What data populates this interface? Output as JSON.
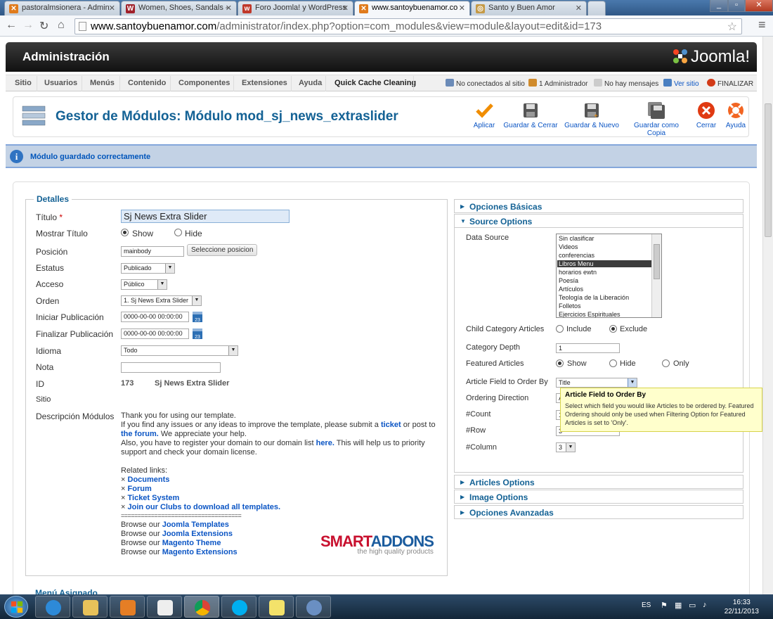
{
  "browser": {
    "tabs": [
      {
        "title": "pastoralmsionera - Admin",
        "active": false
      },
      {
        "title": "Women, Shoes, Sandals -",
        "active": false
      },
      {
        "title": "Foro Joomla! y WordPress",
        "active": false
      },
      {
        "title": "www.santoybuenamor.co",
        "active": true
      },
      {
        "title": "Santo y Buen Amor",
        "active": false
      }
    ],
    "url_host": "www.santoybuenamor.com",
    "url_rest": "/administrator/index.php?option=com_modules&view=module&layout=edit&id=173"
  },
  "admin": {
    "title": "Administración",
    "logo": "Joomla!"
  },
  "menu": {
    "items": [
      "Sitio",
      "Usuarios",
      "Menús",
      "Contenido",
      "Componentes",
      "Extensiones",
      "Ayuda",
      "Quick Cache Cleaning"
    ],
    "status": {
      "not_connected": "No conectados al sitio",
      "admins": "1 Administrador",
      "messages": "No hay mensajes",
      "view_site": "Ver sitio",
      "logout": "FINALIZAR"
    }
  },
  "page": {
    "title": "Gestor de Módulos: Módulo mod_sj_news_extraslider",
    "toolbar": {
      "apply": "Aplicar",
      "save_close": "Guardar & Cerrar",
      "save_new": "Guardar & Nuevo",
      "save_copy": "Guardar como Copia",
      "close": "Cerrar",
      "help": "Ayuda"
    },
    "message": "Módulo guardado correctamente"
  },
  "details": {
    "legend": "Detalles",
    "fields": {
      "title_label": "Título",
      "title_req": "*",
      "title_value": "Sj News Extra Slider",
      "show_title_label": "Mostrar Título",
      "show": "Show",
      "hide": "Hide",
      "position_label": "Posición",
      "position_value": "mainbody",
      "position_button": "Seleccione posicion",
      "status_label": "Estatus",
      "status_value": "Publicado",
      "access_label": "Acceso",
      "access_value": "Público",
      "order_label": "Orden",
      "order_value": "1. Sj News Extra Slider",
      "publish_up_label": "Iniciar Publicación",
      "publish_up_value": "0000-00-00 00:00:00",
      "publish_down_label": "Finalizar Publicación",
      "publish_down_value": "0000-00-00 00:00:00",
      "language_label": "Idioma",
      "language_value": "Todo",
      "note_label": "Nota",
      "id_label": "ID",
      "id_value": "173",
      "id_name": "Sj News Extra Slider",
      "site_label": "Sitio",
      "desc_label": "Descripción Módulos",
      "calendar": "23"
    },
    "description": {
      "line1": "Thank you for using our template.",
      "line2a": "If you find any issues or any ideas to improve the template, please submit a",
      "line2_link": "ticket",
      "line2b": "or post to",
      "line3_link": "the forum.",
      "line3b": "We appreciate your help.",
      "line4a": "Also, you have to register your domain to our domain list",
      "line4_link": "here.",
      "line4b": "This will help us to priority",
      "line5": "support and check your domain license.",
      "related": "Related links:",
      "links": [
        "Documents",
        "Forum",
        "Ticket System",
        "Join our Clubs to download all templates."
      ],
      "bullet": "×",
      "divider": "====================================",
      "browse": [
        {
          "prefix": "Browse our",
          "link": "Joomla Templates"
        },
        {
          "prefix": "Browse our",
          "link": "Joomla Extensions"
        },
        {
          "prefix": "Browse our",
          "link": "Magento Theme"
        },
        {
          "prefix": "Browse our",
          "link": "Magento Extensions"
        }
      ],
      "brand_smart": "SMART",
      "brand_addons": "ADDONS",
      "brand_tag": "the high quality products"
    },
    "next_section": "Menú Asignado"
  },
  "options": {
    "panels": {
      "basic": "Opciones Básicas",
      "source": "Source Options",
      "articles": "Articles Options",
      "image": "Image Options",
      "advanced": "Opciones Avanzadas"
    },
    "source": {
      "data_source_label": "Data Source",
      "data_source_items": [
        "Sin clasificar",
        "Videos",
        "conferencias",
        "Libros Menu",
        "horarios ewtn",
        "Poesía",
        "Artículos",
        "Teología de la Liberación",
        "Folletos",
        "Ejercicios Espirituales"
      ],
      "data_source_selected": "Libros Menu",
      "child_label": "Child Category Articles",
      "include": "Include",
      "exclude": "Exclude",
      "depth_label": "Category Depth",
      "depth_value": "1",
      "featured_label": "Featured Articles",
      "featured_show": "Show",
      "featured_hide": "Hide",
      "featured_only": "Only",
      "order_by_label": "Article Field to Order By",
      "order_by_value": "Title",
      "direction_label": "Ordering Direction",
      "direction_value": "A",
      "count_label": "#Count",
      "count_value": "1",
      "row_label": "#Row",
      "row_value": "3",
      "column_label": "#Column",
      "column_value": "3"
    },
    "tooltip": {
      "title": "Article Field to Order By",
      "text": "Select which field you would like Articles to be ordered by. Featured Ordering should only be used when Filtering Option for Featured Articles is set to 'Only'."
    }
  },
  "taskbar": {
    "lang": "ES",
    "time": "16:33",
    "date": "22/11/2013"
  }
}
